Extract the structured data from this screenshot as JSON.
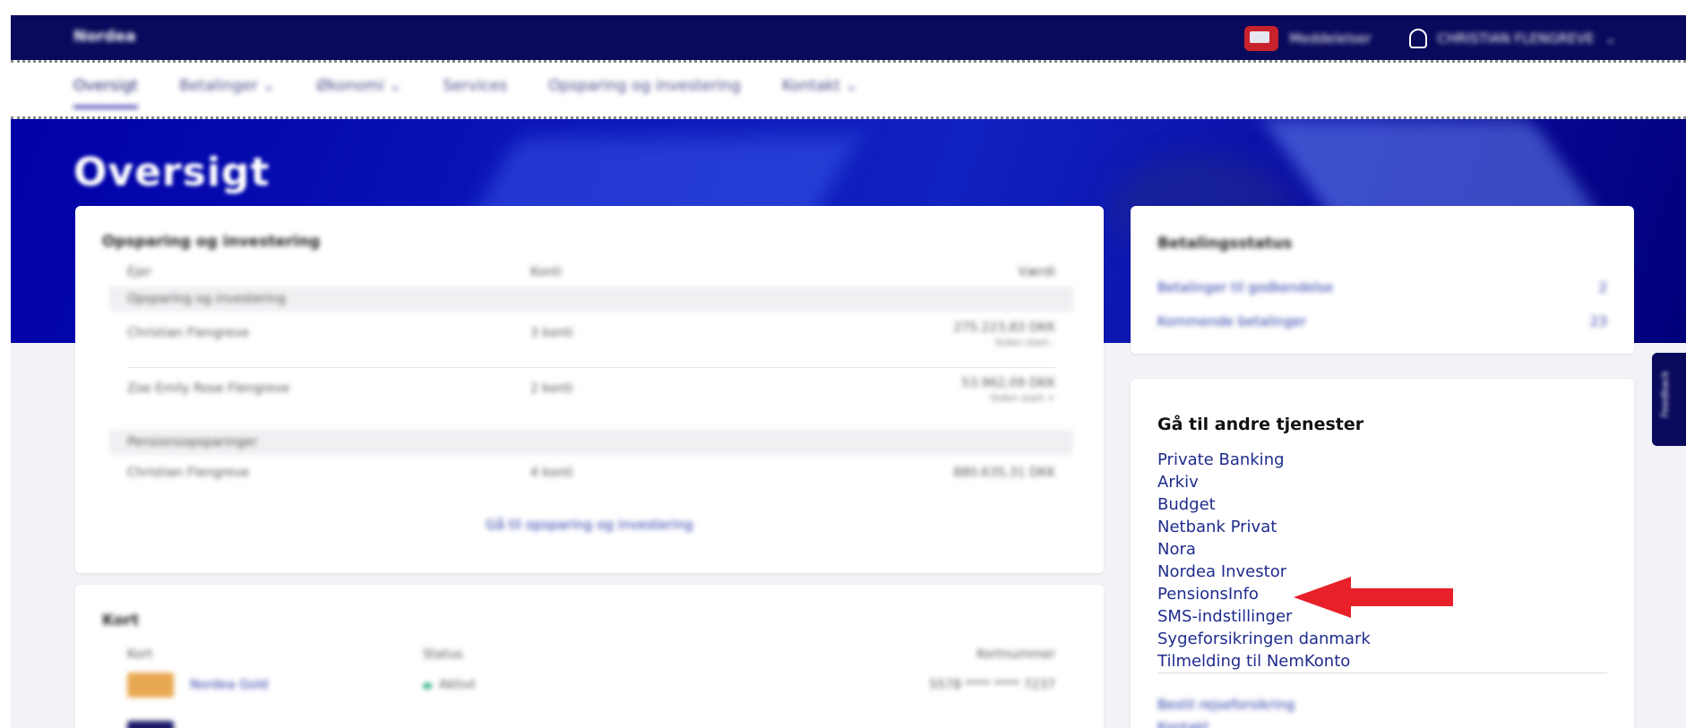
{
  "app": {
    "logo": "Nordea"
  },
  "header": {
    "messages_label": "Meddelelser",
    "user_label": "CHRISTIAN FLENGREVE"
  },
  "nav": {
    "items": [
      {
        "label": "Oversigt",
        "active": true
      },
      {
        "label": "Betalinger ⌄"
      },
      {
        "label": "Økonomi ⌄"
      },
      {
        "label": "Services"
      },
      {
        "label": "Opsparing og investering"
      },
      {
        "label": "Kontakt ⌄"
      }
    ]
  },
  "page": {
    "title": "Oversigt"
  },
  "investment": {
    "title": "Opsparing og investering",
    "headers": [
      "Ejer",
      "Konti",
      "Værdi"
    ],
    "group1": "Opsparing og investering",
    "rows": [
      {
        "owner": "Christian Flengreve",
        "accounts": "3 konti",
        "value": "275.223,83 DKK",
        "sub": "Siden start -"
      },
      {
        "owner": "Zoe Emily Rose Flengreve",
        "accounts": "2 konti",
        "value": "53.962,09 DKK",
        "sub": "Siden start +"
      }
    ],
    "group2": "Pensionsopsparinger",
    "pension_row": {
      "owner": "Christian Flengreve",
      "accounts": "4 konti",
      "value": "880.635,31 DKK"
    },
    "link": "Gå til opsparing og investering"
  },
  "cards": {
    "title": "Kort",
    "headers": [
      "Kort",
      "Status",
      "Kortnummer"
    ],
    "rows": [
      {
        "name": "Nordea Gold",
        "status": "Aktivt",
        "number": "5578 **** **** 7237"
      }
    ]
  },
  "payment_status": {
    "title": "Betalingsstatus",
    "rows": [
      {
        "label": "Betalinger til godkendelse",
        "value": "2"
      },
      {
        "label": "Kommende betalinger",
        "value": "23"
      }
    ]
  },
  "services": {
    "heading": "Gå til andre tjenester",
    "links": [
      "Private Banking",
      "Arkiv",
      "Budget",
      "Netbank Privat",
      "Nora",
      "Nordea Investor",
      "PensionsInfo",
      "SMS-indstillinger",
      "Sygeforsikringen danmark",
      "Tilmelding til NemKonto"
    ],
    "more": [
      "Bestil rejseforsikring",
      "Kontakt"
    ]
  },
  "feedback": {
    "label": "Feedback"
  },
  "colors": {
    "brand": "#0a0a5c",
    "link": "#1f2c8c",
    "arrow": "#e8202a"
  }
}
